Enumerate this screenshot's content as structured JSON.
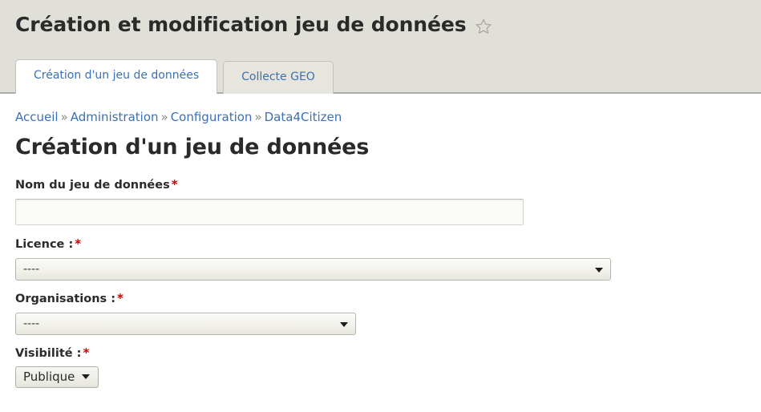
{
  "header": {
    "title": "Création et modification jeu de données",
    "favorite_icon": "star-outline-icon",
    "background_color": "#e0e0d8"
  },
  "tabs": [
    {
      "label": "Création d'un jeu de données",
      "active": true
    },
    {
      "label": "Collecte GEO",
      "active": false
    }
  ],
  "breadcrumb": {
    "items": [
      {
        "label": "Accueil"
      },
      {
        "label": "Administration"
      },
      {
        "label": "Configuration"
      },
      {
        "label": "Data4Citizen"
      }
    ],
    "separator": "»"
  },
  "page": {
    "title": "Création d'un jeu de données",
    "link_color": "#3b6fb6",
    "required_color": "#cc0000"
  },
  "form": {
    "required_marker": "*",
    "fields": {
      "nom": {
        "label": "Nom du jeu de données",
        "value": "",
        "placeholder": ""
      },
      "licence": {
        "label": "Licence :",
        "selected": "----"
      },
      "organisations": {
        "label": "Organisations :",
        "selected": "----"
      },
      "visibilite": {
        "label": "Visibilité :",
        "selected": "Publique"
      }
    }
  }
}
